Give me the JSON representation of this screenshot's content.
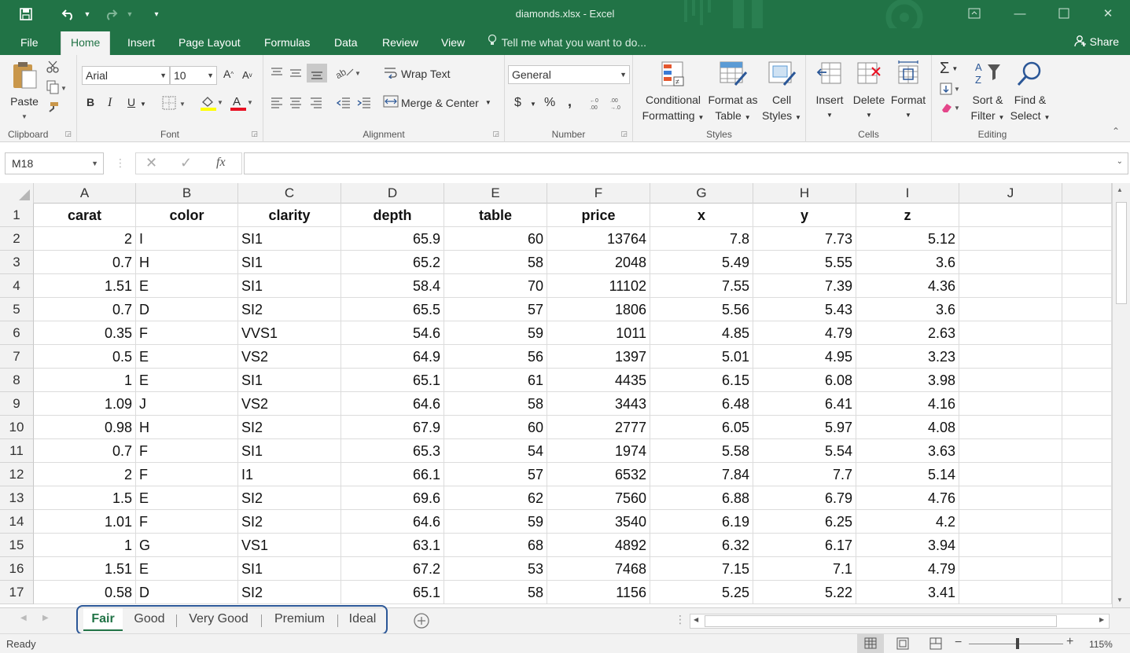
{
  "window": {
    "title": "diamonds.xlsx - Excel"
  },
  "ribbon_tabs": [
    "File",
    "Home",
    "Insert",
    "Page Layout",
    "Formulas",
    "Data",
    "Review",
    "View"
  ],
  "active_tab": "Home",
  "tell_me": "Tell me what you want to do...",
  "share_label": "Share",
  "clipboard": {
    "paste": "Paste",
    "group": "Clipboard"
  },
  "font": {
    "name": "Arial",
    "size": "10",
    "group": "Font",
    "bold": "B",
    "italic": "I",
    "underline": "U"
  },
  "alignment": {
    "wrap": "Wrap Text",
    "merge": "Merge & Center",
    "group": "Alignment"
  },
  "number": {
    "format": "General",
    "currency": "$",
    "percent": "%",
    "comma": ",",
    "group": "Number"
  },
  "styles": {
    "conditional_1": "Conditional",
    "conditional_2": "Formatting",
    "format_table_1": "Format as",
    "format_table_2": "Table",
    "cell_styles_1": "Cell",
    "cell_styles_2": "Styles",
    "group": "Styles"
  },
  "cells_group": {
    "insert": "Insert",
    "delete": "Delete",
    "format": "Format",
    "group": "Cells"
  },
  "editing": {
    "sort_1": "Sort &",
    "sort_2": "Filter",
    "find_1": "Find &",
    "find_2": "Select",
    "group": "Editing"
  },
  "formula_bar": {
    "name_box": "M18",
    "fx": "fx",
    "value": ""
  },
  "columns": [
    "A",
    "B",
    "C",
    "D",
    "E",
    "F",
    "G",
    "H",
    "I",
    "J"
  ],
  "headers": [
    "carat",
    "color",
    "clarity",
    "depth",
    "table",
    "price",
    "x",
    "y",
    "z"
  ],
  "rows": [
    [
      "2",
      "I",
      "SI1",
      "65.9",
      "60",
      "13764",
      "7.8",
      "7.73",
      "5.12"
    ],
    [
      "0.7",
      "H",
      "SI1",
      "65.2",
      "58",
      "2048",
      "5.49",
      "5.55",
      "3.6"
    ],
    [
      "1.51",
      "E",
      "SI1",
      "58.4",
      "70",
      "11102",
      "7.55",
      "7.39",
      "4.36"
    ],
    [
      "0.7",
      "D",
      "SI2",
      "65.5",
      "57",
      "1806",
      "5.56",
      "5.43",
      "3.6"
    ],
    [
      "0.35",
      "F",
      "VVS1",
      "54.6",
      "59",
      "1011",
      "4.85",
      "4.79",
      "2.63"
    ],
    [
      "0.5",
      "E",
      "VS2",
      "64.9",
      "56",
      "1397",
      "5.01",
      "4.95",
      "3.23"
    ],
    [
      "1",
      "E",
      "SI1",
      "65.1",
      "61",
      "4435",
      "6.15",
      "6.08",
      "3.98"
    ],
    [
      "1.09",
      "J",
      "VS2",
      "64.6",
      "58",
      "3443",
      "6.48",
      "6.41",
      "4.16"
    ],
    [
      "0.98",
      "H",
      "SI2",
      "67.9",
      "60",
      "2777",
      "6.05",
      "5.97",
      "4.08"
    ],
    [
      "0.7",
      "F",
      "SI1",
      "65.3",
      "54",
      "1974",
      "5.58",
      "5.54",
      "3.63"
    ],
    [
      "2",
      "F",
      "I1",
      "66.1",
      "57",
      "6532",
      "7.84",
      "7.7",
      "5.14"
    ],
    [
      "1.5",
      "E",
      "SI2",
      "69.6",
      "62",
      "7560",
      "6.88",
      "6.79",
      "4.76"
    ],
    [
      "1.01",
      "F",
      "SI2",
      "64.6",
      "59",
      "3540",
      "6.19",
      "6.25",
      "4.2"
    ],
    [
      "1",
      "G",
      "VS1",
      "63.1",
      "68",
      "4892",
      "6.32",
      "6.17",
      "3.94"
    ],
    [
      "1.51",
      "E",
      "SI1",
      "67.2",
      "53",
      "7468",
      "7.15",
      "7.1",
      "4.79"
    ],
    [
      "0.58",
      "D",
      "SI2",
      "65.1",
      "58",
      "1156",
      "5.25",
      "5.22",
      "3.41"
    ]
  ],
  "sheets": [
    "Fair",
    "Good",
    "Very Good",
    "Premium",
    "Ideal"
  ],
  "active_sheet": "Fair",
  "status": {
    "text": "Ready",
    "zoom": "115%"
  },
  "colors": {
    "accent": "#217346",
    "highlight_border": "#2b5797"
  }
}
